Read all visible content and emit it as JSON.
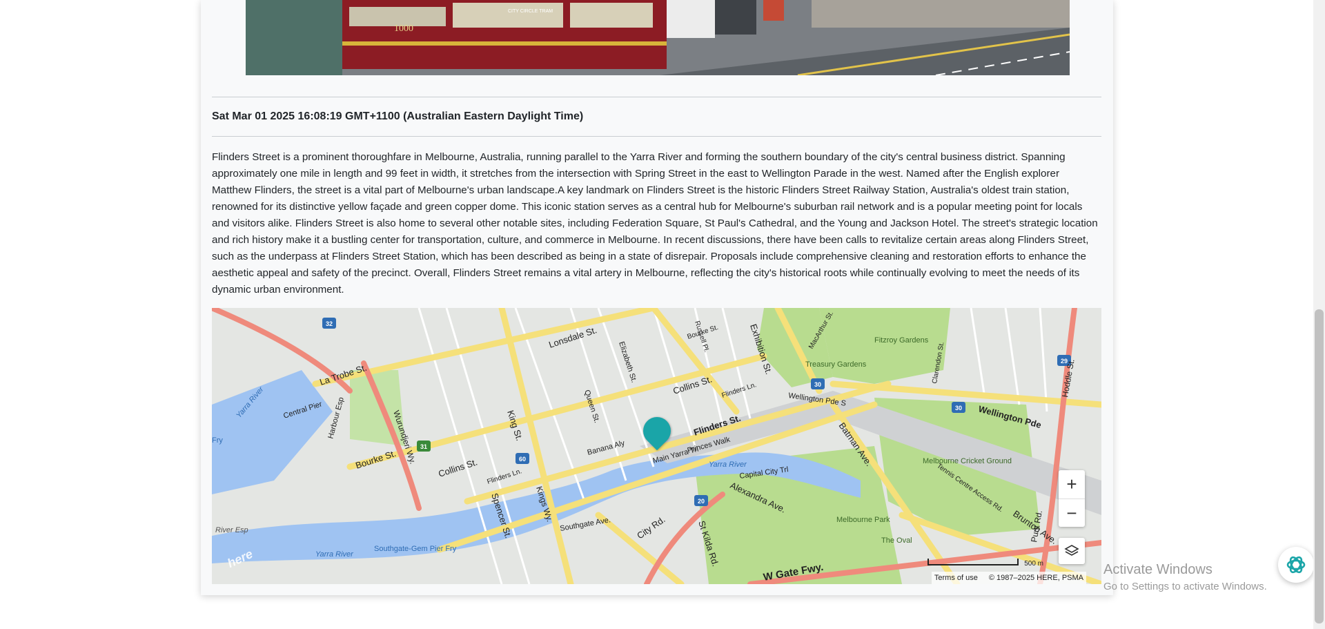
{
  "datetime": "Sat Mar 01 2025 16:08:19 GMT+1100 (Australian Eastern Daylight Time)",
  "description": "Flinders Street is a prominent thoroughfare in Melbourne, Australia, running parallel to the Yarra River and forming the southern boundary of the city's central business district. Spanning approximately one mile in length and 99 feet in width, it stretches from the intersection with Spring Street in the east to Wellington Parade in the west. Named after the English explorer Matthew Flinders, the street is a vital part of Melbourne's urban landscape.A key landmark on Flinders Street is the historic Flinders Street Railway Station, Australia's oldest train station, renowned for its distinctive yellow façade and green copper dome. This iconic station serves as a central hub for Melbourne's suburban rail network and is a popular meeting point for locals and visitors alike. Flinders Street is also home to several other notable sites, including Federation Square, St Paul's Cathedral, and the Young and Jackson Hotel. The street's strategic location and rich history make it a bustling center for transportation, culture, and commerce in Melbourne. In recent discussions, there have been calls to revitalize certain areas along Flinders Street, such as the underpass at Flinders Street Station, which has been described as being in a state of disrepair. Proposals include comprehensive cleaning and restoration efforts to enhance the aesthetic appeal and safety of the precinct. Overall, Flinders Street remains a vital artery in Melbourne, reflecting the city's historical roots while continually evolving to meet the needs of its dynamic urban environment.",
  "photo": {
    "tram_number": "1000",
    "tram_sign": "CITY CIRCLE TRAM"
  },
  "map": {
    "labels": {
      "lonsdale": "Lonsdale St.",
      "latrobe": "La Trobe St.",
      "collins_e": "Collins St.",
      "collins_w": "Collins St.",
      "bourke_w": "Bourke St.",
      "bourke_n": "Bourke St.",
      "flinders": "Flinders St.",
      "flinders_ln": "Flinders Ln.",
      "flinders_ln_w": "Flinders Ln.",
      "king": "King St.",
      "spencer": "Spencer St.",
      "exhibition": "Exhibition St.",
      "wellington_pde": "Wellington Pde",
      "wellington_pde_s": "Wellington Pde S",
      "batman": "Batman Ave.",
      "brunton": "Brunton Ave.",
      "alexandra": "Alexandra Ave.",
      "stkilda": "St Kilda Rd.",
      "city_rd": "City Rd.",
      "wgate": "W Gate Fwy.",
      "yarra": "Yarra River",
      "yarra_w": "Yarra River",
      "yarra_sw": "Yarra River",
      "river_esp": "River Esp",
      "fitzroy": "Fitzroy Gardens",
      "treasury": "Treasury Gardens",
      "mcg": "Melbourne Cricket Ground",
      "melbourne_park": "Melbourne Park",
      "the_oval": "The Oval",
      "southgate_pier": "Southgate-Gem Pier Fry",
      "princes_walk": "Princes Walk",
      "main_yarra_trl": "Main Yarra Trl",
      "capital_city_trl": "Capital City Trl",
      "banana_aly": "Banana Aly",
      "southgate_ave": "Southgate Ave.",
      "central_pier": "Central Pier",
      "harbour_esp": "Harbour Esp",
      "wurundjeri": "Wurundjeri Wy.",
      "kings_wy": "Kings Wy.",
      "queen": "Queen St.",
      "elizabeth": "Elizabeth St.",
      "russell": "Russell Pl.",
      "macarthur": "MacArthur St.",
      "hoddle": "Hoddle St.",
      "punt": "Punt Rd.",
      "clarendon": "Clarendon St.",
      "tennis_centre": "Tennis Centre Access Rd.",
      "fry": "Fry"
    },
    "shields": [
      "32",
      "31",
      "60",
      "30",
      "30",
      "29",
      "20"
    ],
    "zoom_in": "+",
    "zoom_out": "−",
    "scale": "500 m",
    "terms": "Terms of use",
    "copyright": "© 1987–2025 HERE, PSMA",
    "logo": "here"
  },
  "watermark": {
    "line1": "Activate Windows",
    "line2": "Go to Settings to activate Windows."
  },
  "colors": {
    "marker": "#1aa5a8",
    "major_road": "#f5e07a",
    "water": "#9fc3f2",
    "park": "#b8dc8f",
    "highway": "#ef8a7c",
    "assistant_icon": "#1aa5a8"
  },
  "icons": {
    "layers": "layers-icon",
    "location_marker": "location-marker-icon",
    "assistant": "assistant-logo-icon"
  }
}
